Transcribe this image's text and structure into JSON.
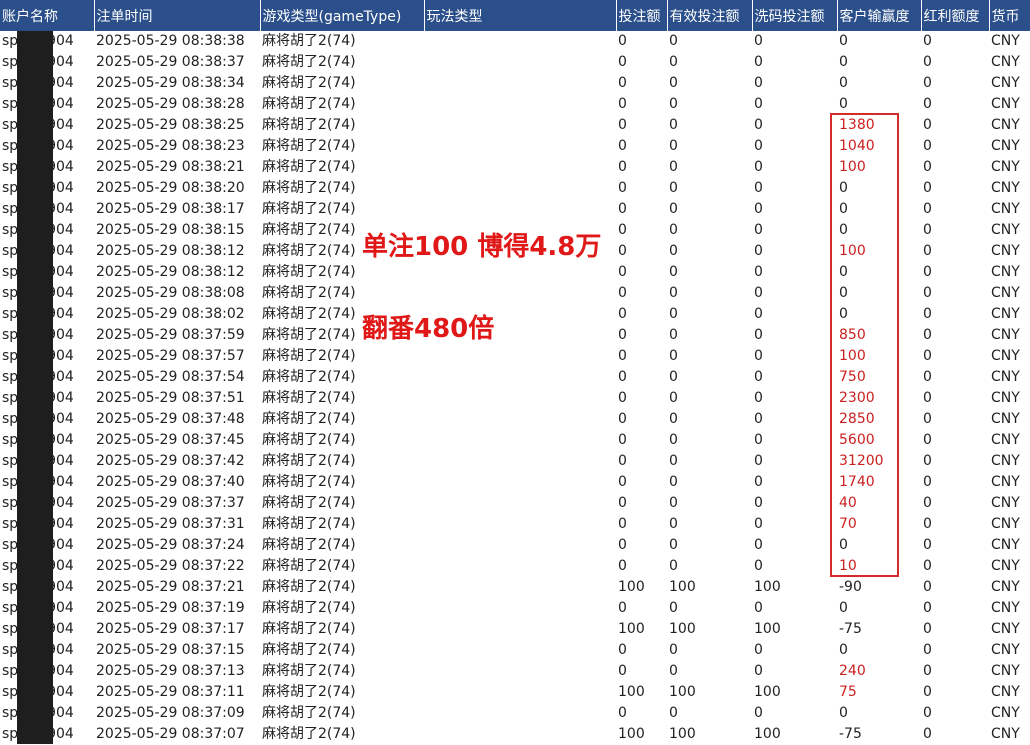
{
  "colors": {
    "header_bg": "#2b4f8a",
    "highlight": "#cc2020",
    "mask": "#1e1e1e"
  },
  "headers": [
    "账户名称",
    "注单时间",
    "游戏类型(gameType)",
    "玩法类型",
    "投注额",
    "有效投注额",
    "洗码投注额",
    "客户输赢度",
    "红利额度",
    "货币"
  ],
  "annotation": {
    "line1": "单注100 博得4.8万",
    "line2": "翻番480倍"
  },
  "rows": [
    {
      "acct_a": "sp",
      "acct_b": "8904",
      "time": "2025-05-29 08:38:38",
      "game": "麻将胡了2(74)",
      "play": "",
      "bet": "0",
      "valid": "0",
      "wash": "0",
      "win": "0",
      "bonus": "0",
      "cur": "CNY",
      "hl": false
    },
    {
      "acct_a": "sp",
      "acct_b": "8904",
      "time": "2025-05-29 08:38:37",
      "game": "麻将胡了2(74)",
      "play": "",
      "bet": "0",
      "valid": "0",
      "wash": "0",
      "win": "0",
      "bonus": "0",
      "cur": "CNY",
      "hl": false
    },
    {
      "acct_a": "sp",
      "acct_b": "8904",
      "time": "2025-05-29 08:38:34",
      "game": "麻将胡了2(74)",
      "play": "",
      "bet": "0",
      "valid": "0",
      "wash": "0",
      "win": "0",
      "bonus": "0",
      "cur": "CNY",
      "hl": false
    },
    {
      "acct_a": "sp",
      "acct_b": "8904",
      "time": "2025-05-29 08:38:28",
      "game": "麻将胡了2(74)",
      "play": "",
      "bet": "0",
      "valid": "0",
      "wash": "0",
      "win": "0",
      "bonus": "0",
      "cur": "CNY",
      "hl": false
    },
    {
      "acct_a": "sp",
      "acct_b": "8904",
      "time": "2025-05-29 08:38:25",
      "game": "麻将胡了2(74)",
      "play": "",
      "bet": "0",
      "valid": "0",
      "wash": "0",
      "win": "1380",
      "bonus": "0",
      "cur": "CNY",
      "hl": true
    },
    {
      "acct_a": "sp",
      "acct_b": "8904",
      "time": "2025-05-29 08:38:23",
      "game": "麻将胡了2(74)",
      "play": "",
      "bet": "0",
      "valid": "0",
      "wash": "0",
      "win": "1040",
      "bonus": "0",
      "cur": "CNY",
      "hl": true
    },
    {
      "acct_a": "sp",
      "acct_b": "8904",
      "time": "2025-05-29 08:38:21",
      "game": "麻将胡了2(74)",
      "play": "",
      "bet": "0",
      "valid": "0",
      "wash": "0",
      "win": "100",
      "bonus": "0",
      "cur": "CNY",
      "hl": true
    },
    {
      "acct_a": "sp",
      "acct_b": "8904",
      "time": "2025-05-29 08:38:20",
      "game": "麻将胡了2(74)",
      "play": "",
      "bet": "0",
      "valid": "0",
      "wash": "0",
      "win": "0",
      "bonus": "0",
      "cur": "CNY",
      "hl": false
    },
    {
      "acct_a": "sp",
      "acct_b": "8904",
      "time": "2025-05-29 08:38:17",
      "game": "麻将胡了2(74)",
      "play": "",
      "bet": "0",
      "valid": "0",
      "wash": "0",
      "win": "0",
      "bonus": "0",
      "cur": "CNY",
      "hl": false
    },
    {
      "acct_a": "sp",
      "acct_b": "8904",
      "time": "2025-05-29 08:38:15",
      "game": "麻将胡了2(74)",
      "play": "",
      "bet": "0",
      "valid": "0",
      "wash": "0",
      "win": "0",
      "bonus": "0",
      "cur": "CNY",
      "hl": false
    },
    {
      "acct_a": "sp",
      "acct_b": "8904",
      "time": "2025-05-29 08:38:12",
      "game": "麻将胡了2(74)",
      "play": "",
      "bet": "0",
      "valid": "0",
      "wash": "0",
      "win": "100",
      "bonus": "0",
      "cur": "CNY",
      "hl": true
    },
    {
      "acct_a": "sp",
      "acct_b": "8904",
      "time": "2025-05-29 08:38:12",
      "game": "麻将胡了2(74)",
      "play": "",
      "bet": "0",
      "valid": "0",
      "wash": "0",
      "win": "0",
      "bonus": "0",
      "cur": "CNY",
      "hl": false
    },
    {
      "acct_a": "sp",
      "acct_b": "8904",
      "time": "2025-05-29 08:38:08",
      "game": "麻将胡了2(74)",
      "play": "",
      "bet": "0",
      "valid": "0",
      "wash": "0",
      "win": "0",
      "bonus": "0",
      "cur": "CNY",
      "hl": false
    },
    {
      "acct_a": "sp",
      "acct_b": "8904",
      "time": "2025-05-29 08:38:02",
      "game": "麻将胡了2(74)",
      "play": "",
      "bet": "0",
      "valid": "0",
      "wash": "0",
      "win": "0",
      "bonus": "0",
      "cur": "CNY",
      "hl": false
    },
    {
      "acct_a": "sp",
      "acct_b": "8904",
      "time": "2025-05-29 08:37:59",
      "game": "麻将胡了2(74)",
      "play": "",
      "bet": "0",
      "valid": "0",
      "wash": "0",
      "win": "850",
      "bonus": "0",
      "cur": "CNY",
      "hl": true
    },
    {
      "acct_a": "sp",
      "acct_b": "8904",
      "time": "2025-05-29 08:37:57",
      "game": "麻将胡了2(74)",
      "play": "",
      "bet": "0",
      "valid": "0",
      "wash": "0",
      "win": "100",
      "bonus": "0",
      "cur": "CNY",
      "hl": true
    },
    {
      "acct_a": "sp",
      "acct_b": "8904",
      "time": "2025-05-29 08:37:54",
      "game": "麻将胡了2(74)",
      "play": "",
      "bet": "0",
      "valid": "0",
      "wash": "0",
      "win": "750",
      "bonus": "0",
      "cur": "CNY",
      "hl": true
    },
    {
      "acct_a": "sp",
      "acct_b": "8904",
      "time": "2025-05-29 08:37:51",
      "game": "麻将胡了2(74)",
      "play": "",
      "bet": "0",
      "valid": "0",
      "wash": "0",
      "win": "2300",
      "bonus": "0",
      "cur": "CNY",
      "hl": true
    },
    {
      "acct_a": "sp",
      "acct_b": "8904",
      "time": "2025-05-29 08:37:48",
      "game": "麻将胡了2(74)",
      "play": "",
      "bet": "0",
      "valid": "0",
      "wash": "0",
      "win": "2850",
      "bonus": "0",
      "cur": "CNY",
      "hl": true
    },
    {
      "acct_a": "sp",
      "acct_b": "8904",
      "time": "2025-05-29 08:37:45",
      "game": "麻将胡了2(74)",
      "play": "",
      "bet": "0",
      "valid": "0",
      "wash": "0",
      "win": "5600",
      "bonus": "0",
      "cur": "CNY",
      "hl": true
    },
    {
      "acct_a": "sp",
      "acct_b": "8904",
      "time": "2025-05-29 08:37:42",
      "game": "麻将胡了2(74)",
      "play": "",
      "bet": "0",
      "valid": "0",
      "wash": "0",
      "win": "31200",
      "bonus": "0",
      "cur": "CNY",
      "hl": true
    },
    {
      "acct_a": "sp",
      "acct_b": "8904",
      "time": "2025-05-29 08:37:40",
      "game": "麻将胡了2(74)",
      "play": "",
      "bet": "0",
      "valid": "0",
      "wash": "0",
      "win": "1740",
      "bonus": "0",
      "cur": "CNY",
      "hl": true
    },
    {
      "acct_a": "sp",
      "acct_b": "8904",
      "time": "2025-05-29 08:37:37",
      "game": "麻将胡了2(74)",
      "play": "",
      "bet": "0",
      "valid": "0",
      "wash": "0",
      "win": "40",
      "bonus": "0",
      "cur": "CNY",
      "hl": true
    },
    {
      "acct_a": "sp",
      "acct_b": "8904",
      "time": "2025-05-29 08:37:31",
      "game": "麻将胡了2(74)",
      "play": "",
      "bet": "0",
      "valid": "0",
      "wash": "0",
      "win": "70",
      "bonus": "0",
      "cur": "CNY",
      "hl": true
    },
    {
      "acct_a": "sp",
      "acct_b": "8904",
      "time": "2025-05-29 08:37:24",
      "game": "麻将胡了2(74)",
      "play": "",
      "bet": "0",
      "valid": "0",
      "wash": "0",
      "win": "0",
      "bonus": "0",
      "cur": "CNY",
      "hl": false
    },
    {
      "acct_a": "sp",
      "acct_b": "8904",
      "time": "2025-05-29 08:37:22",
      "game": "麻将胡了2(74)",
      "play": "",
      "bet": "0",
      "valid": "0",
      "wash": "0",
      "win": "10",
      "bonus": "0",
      "cur": "CNY",
      "hl": true
    },
    {
      "acct_a": "sp",
      "acct_b": "8904",
      "time": "2025-05-29 08:37:21",
      "game": "麻将胡了2(74)",
      "play": "",
      "bet": "100",
      "valid": "100",
      "wash": "100",
      "win": "-90",
      "bonus": "0",
      "cur": "CNY",
      "hl": false
    },
    {
      "acct_a": "sp",
      "acct_b": "8904",
      "time": "2025-05-29 08:37:19",
      "game": "麻将胡了2(74)",
      "play": "",
      "bet": "0",
      "valid": "0",
      "wash": "0",
      "win": "0",
      "bonus": "0",
      "cur": "CNY",
      "hl": false
    },
    {
      "acct_a": "sp",
      "acct_b": "8904",
      "time": "2025-05-29 08:37:17",
      "game": "麻将胡了2(74)",
      "play": "",
      "bet": "100",
      "valid": "100",
      "wash": "100",
      "win": "-75",
      "bonus": "0",
      "cur": "CNY",
      "hl": false
    },
    {
      "acct_a": "sp",
      "acct_b": "8904",
      "time": "2025-05-29 08:37:15",
      "game": "麻将胡了2(74)",
      "play": "",
      "bet": "0",
      "valid": "0",
      "wash": "0",
      "win": "0",
      "bonus": "0",
      "cur": "CNY",
      "hl": false
    },
    {
      "acct_a": "sp",
      "acct_b": "8904",
      "time": "2025-05-29 08:37:13",
      "game": "麻将胡了2(74)",
      "play": "",
      "bet": "0",
      "valid": "0",
      "wash": "0",
      "win": "240",
      "bonus": "0",
      "cur": "CNY",
      "hl": true
    },
    {
      "acct_a": "sp",
      "acct_b": "8904",
      "time": "2025-05-29 08:37:11",
      "game": "麻将胡了2(74)",
      "play": "",
      "bet": "100",
      "valid": "100",
      "wash": "100",
      "win": "75",
      "bonus": "0",
      "cur": "CNY",
      "hl": true
    },
    {
      "acct_a": "sp",
      "acct_b": "8904",
      "time": "2025-05-29 08:37:09",
      "game": "麻将胡了2(74)",
      "play": "",
      "bet": "0",
      "valid": "0",
      "wash": "0",
      "win": "0",
      "bonus": "0",
      "cur": "CNY",
      "hl": false
    },
    {
      "acct_a": "sp",
      "acct_b": "8904",
      "time": "2025-05-29 08:37:07",
      "game": "麻将胡了2(74)",
      "play": "",
      "bet": "100",
      "valid": "100",
      "wash": "100",
      "win": "-75",
      "bonus": "0",
      "cur": "CNY",
      "hl": false
    }
  ]
}
